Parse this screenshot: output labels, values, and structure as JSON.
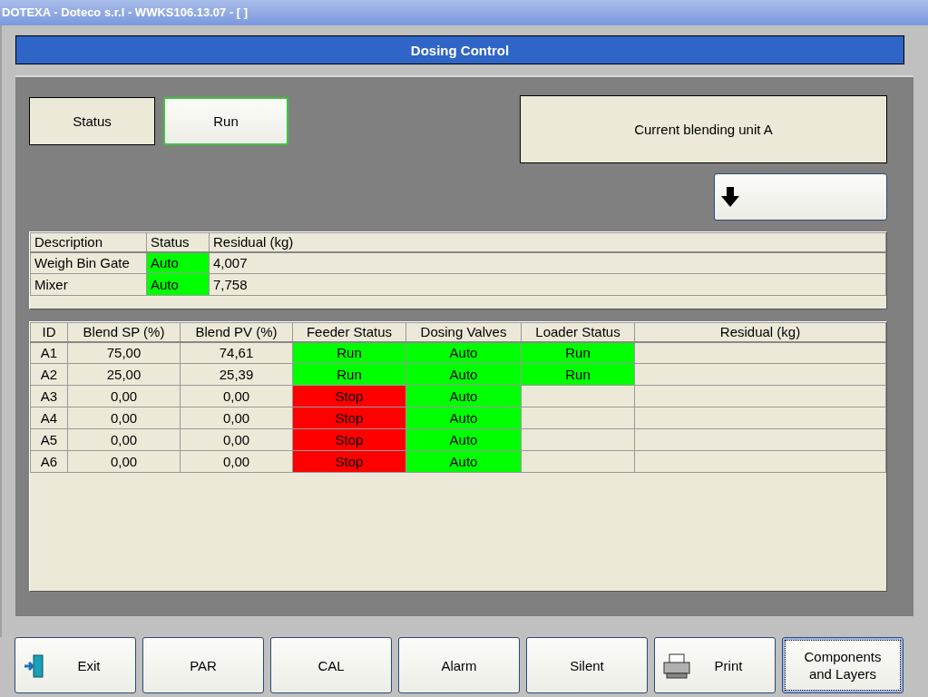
{
  "window": {
    "title": "DOTEXA - Doteco s.r.l - WWKS106.13.07 - [ ]"
  },
  "header": {
    "title": "Dosing Control"
  },
  "status_label": "Status",
  "run_button": {
    "label": "Run",
    "active": true
  },
  "unit_info": "Current blending unit A",
  "devices_table": {
    "columns": [
      "Description",
      "Status",
      "Residual (kg)"
    ],
    "rows": [
      {
        "description": "Weigh Bin Gate",
        "status": {
          "text": "Auto",
          "color": "#00ff00"
        },
        "residual": "4,007"
      },
      {
        "description": "Mixer",
        "status": {
          "text": "Auto",
          "color": "#00ff00"
        },
        "residual": "7,758"
      }
    ]
  },
  "components_table": {
    "columns": [
      "ID",
      "Blend SP (%)",
      "Blend PV (%)",
      "Feeder Status",
      "Dosing Valves",
      "Loader Status",
      "Residual (kg)"
    ],
    "rows": [
      {
        "id": "A1",
        "sp": "75,00",
        "pv": "74,61",
        "feeder": {
          "text": "Run",
          "color": "#00ff00"
        },
        "valves": {
          "text": "Auto",
          "color": "#00ff00"
        },
        "loader": {
          "text": "Run",
          "color": "#00ff00"
        }
      },
      {
        "id": "A2",
        "sp": "25,00",
        "pv": "25,39",
        "feeder": {
          "text": "Run",
          "color": "#00ff00"
        },
        "valves": {
          "text": "Auto",
          "color": "#00ff00"
        },
        "loader": {
          "text": "Run",
          "color": "#00ff00"
        }
      },
      {
        "id": "A3",
        "sp": "0,00",
        "pv": "0,00",
        "feeder": {
          "text": "Stop",
          "color": "#ff0000"
        },
        "valves": {
          "text": "Auto",
          "color": "#00ff00"
        }
      },
      {
        "id": "A4",
        "sp": "0,00",
        "pv": "0,00",
        "feeder": {
          "text": "Stop",
          "color": "#ff0000"
        },
        "valves": {
          "text": "Auto",
          "color": "#00ff00"
        }
      },
      {
        "id": "A5",
        "sp": "0,00",
        "pv": "0,00",
        "feeder": {
          "text": "Stop",
          "color": "#ff0000"
        },
        "valves": {
          "text": "Auto",
          "color": "#00ff00"
        }
      },
      {
        "id": "A6",
        "sp": "0,00",
        "pv": "0,00",
        "feeder": {
          "text": "Stop",
          "color": "#ff0000"
        },
        "valves": {
          "text": "Auto",
          "color": "#00ff00"
        }
      }
    ]
  },
  "footer_buttons": [
    {
      "label": "Exit",
      "kind": "exit",
      "focused": false
    },
    {
      "label": "PAR",
      "kind": "plain",
      "focused": false
    },
    {
      "label": "CAL",
      "kind": "plain",
      "focused": false
    },
    {
      "label": "Alarm",
      "kind": "plain",
      "focused": false
    },
    {
      "label": "Silent",
      "kind": "plain",
      "focused": false
    },
    {
      "label": "Print",
      "kind": "print",
      "focused": false
    },
    {
      "label": "Components and Layers",
      "kind": "plain",
      "focused": true
    }
  ]
}
